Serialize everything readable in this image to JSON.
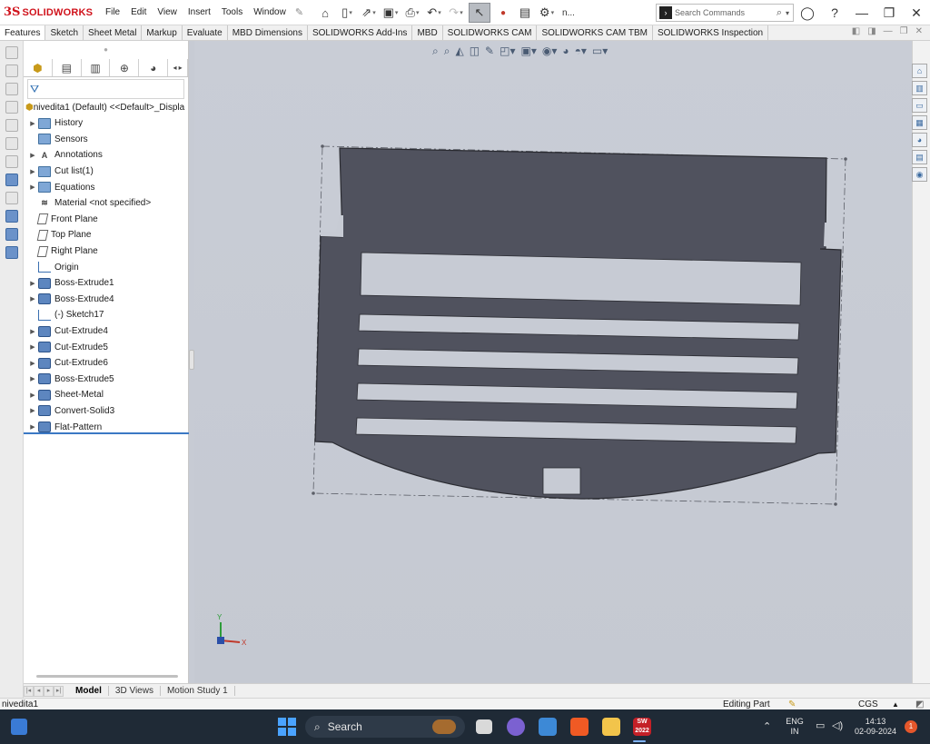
{
  "app": {
    "logo_mark": "3S",
    "brand": "SOLIDWORKS",
    "menu": [
      "File",
      "Edit",
      "View",
      "Insert",
      "Tools",
      "Window"
    ],
    "overflow_label": "n...",
    "search_placeholder": "Search Commands"
  },
  "tabs": [
    "Features",
    "Sketch",
    "Sheet Metal",
    "Markup",
    "Evaluate",
    "MBD Dimensions",
    "SOLIDWORKS Add-Ins",
    "MBD",
    "SOLIDWORKS CAM",
    "SOLIDWORKS CAM TBM",
    "SOLIDWORKS Inspection"
  ],
  "feature_tree": {
    "root": "nivedita1 (Default) <<Default>_Displa",
    "items": [
      {
        "label": "History",
        "icon": "history-folder-icon",
        "expandable": true
      },
      {
        "label": "Sensors",
        "icon": "sensors-folder-icon",
        "expandable": false
      },
      {
        "label": "Annotations",
        "icon": "annotations-icon",
        "expandable": true
      },
      {
        "label": "Cut list(1)",
        "icon": "cut-list-icon",
        "expandable": true
      },
      {
        "label": "Equations",
        "icon": "equations-icon",
        "expandable": true
      },
      {
        "label": "Material <not specified>",
        "icon": "material-icon",
        "expandable": false
      },
      {
        "label": "Front Plane",
        "icon": "plane-icon",
        "expandable": false
      },
      {
        "label": "Top Plane",
        "icon": "plane-icon",
        "expandable": false
      },
      {
        "label": "Right Plane",
        "icon": "plane-icon",
        "expandable": false
      },
      {
        "label": "Origin",
        "icon": "origin-icon",
        "expandable": false
      },
      {
        "label": "Boss-Extrude1",
        "icon": "boss-extrude-icon",
        "expandable": true
      },
      {
        "label": "Boss-Extrude4",
        "icon": "boss-extrude-icon",
        "expandable": true
      },
      {
        "label": "(-) Sketch17",
        "icon": "sketch-icon",
        "expandable": false
      },
      {
        "label": "Cut-Extrude4",
        "icon": "cut-extrude-icon",
        "expandable": true
      },
      {
        "label": "Cut-Extrude5",
        "icon": "cut-extrude-icon",
        "expandable": true
      },
      {
        "label": "Cut-Extrude6",
        "icon": "cut-extrude-icon",
        "expandable": true
      },
      {
        "label": "Boss-Extrude5",
        "icon": "boss-extrude-icon",
        "expandable": true
      },
      {
        "label": "Sheet-Metal",
        "icon": "sheet-metal-icon",
        "expandable": true
      },
      {
        "label": "Convert-Solid3",
        "icon": "convert-solid-icon",
        "expandable": true
      },
      {
        "label": "Flat-Pattern",
        "icon": "flat-pattern-icon",
        "expandable": true
      }
    ]
  },
  "model_tabs": {
    "items": [
      "Model",
      "3D Views",
      "Motion Study 1"
    ],
    "active": "Model"
  },
  "triad": {
    "y_label": "Y",
    "x_label": "X"
  },
  "status": {
    "document": "nivedita1",
    "mode": "Editing Part",
    "units": "CGS"
  },
  "taskbar": {
    "search_label": "Search",
    "app_badge": "SW 2022",
    "language": [
      "ENG",
      "IN"
    ],
    "time": "14:13",
    "date": "02-09-2024",
    "notifications": "1"
  },
  "colors": {
    "part_fill": "#50525e",
    "viewport_bg": "#c7cbd4",
    "brand_red": "#d0121b",
    "accent_blue": "#3b78c4"
  }
}
